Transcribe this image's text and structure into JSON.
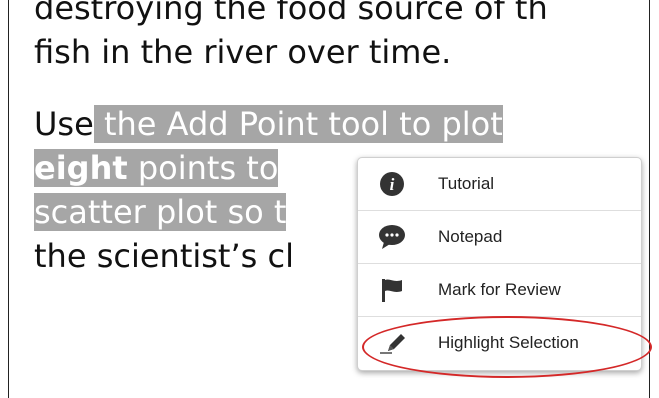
{
  "passage": {
    "line1": "destroying the food source of th",
    "line2": "fish in the river over time.",
    "line3_use": "Use",
    "line3_hl": " the Add Point tool to plot",
    "line4_bold": "eight",
    "line4_rest": " points to",
    "line5_hl": "scatter plot so t",
    "line6": "the scientist’s cl"
  },
  "context_menu": {
    "items": [
      {
        "label": "Tutorial",
        "icon": "info-icon"
      },
      {
        "label": "Notepad",
        "icon": "speech-bubble-icon"
      },
      {
        "label": "Mark for Review",
        "icon": "flag-icon"
      },
      {
        "label": "Highlight Selection",
        "icon": "pencil-icon"
      }
    ]
  },
  "annotation": {
    "circle_color": "#d42828"
  }
}
